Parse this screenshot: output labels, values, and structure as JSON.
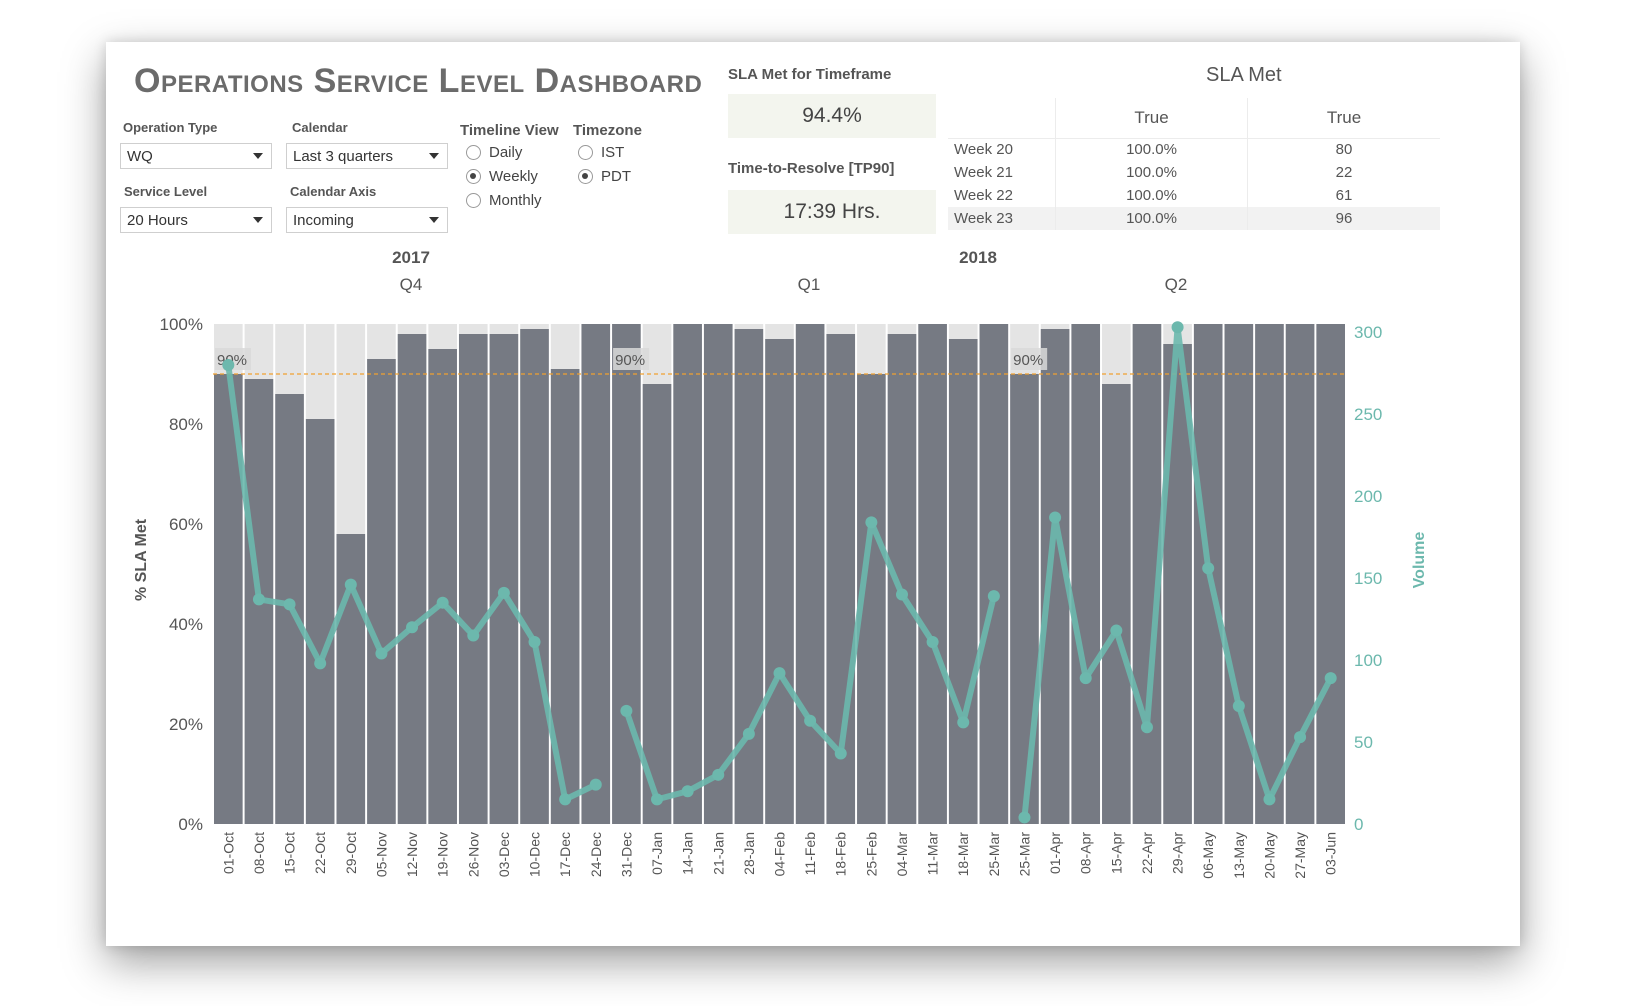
{
  "title": "Operations Service Level Dashboard",
  "filters": {
    "operation_type": {
      "label": "Operation Type",
      "value": "WQ"
    },
    "calendar": {
      "label": "Calendar",
      "value": "Last 3 quarters"
    },
    "service_level": {
      "label": "Service Level",
      "value": "20 Hours"
    },
    "calendar_axis": {
      "label": "Calendar Axis",
      "value": "Incoming"
    },
    "timeline_view": {
      "label": "Timeline View",
      "options": [
        "Daily",
        "Weekly",
        "Monthly"
      ],
      "selected": "Weekly"
    },
    "timezone": {
      "label": "Timezone",
      "options": [
        "IST",
        "PDT"
      ],
      "selected": "PDT"
    }
  },
  "kpis": {
    "sla_met_label": "SLA Met for Timeframe",
    "sla_met_value": "94.4%",
    "ttr_label": "Time-to-Resolve [TP90]",
    "ttr_value": "17:39 Hrs."
  },
  "sla_table": {
    "title": "SLA Met",
    "headers": [
      "",
      "True",
      "True"
    ],
    "rows": [
      [
        "Week 20",
        "100.0%",
        "80"
      ],
      [
        "Week 21",
        "100.0%",
        "22"
      ],
      [
        "Week 22",
        "100.0%",
        "61"
      ],
      [
        "Week 23",
        "100.0%",
        "96"
      ]
    ]
  },
  "chart_data": {
    "type": "bar+line",
    "year_labels": [
      {
        "year": "2017",
        "quarter": "Q4"
      },
      {
        "year": "2018",
        "quarter": "Q1"
      },
      {
        "year": "",
        "quarter": "Q2"
      }
    ],
    "ylabel_left": "% SLA Met",
    "ylabel_right": "Volume",
    "left_ticks": [
      "0%",
      "20%",
      "40%",
      "60%",
      "80%",
      "100%"
    ],
    "right_ticks": [
      "0",
      "50",
      "100",
      "150",
      "200",
      "250",
      "300"
    ],
    "ylim_left": [
      0,
      100
    ],
    "ylim_right": [
      0,
      305
    ],
    "target_line": {
      "value": 90,
      "label": "90%"
    },
    "categories": [
      "01-Oct",
      "08-Oct",
      "15-Oct",
      "22-Oct",
      "29-Oct",
      "05-Nov",
      "12-Nov",
      "19-Nov",
      "26-Nov",
      "03-Dec",
      "10-Dec",
      "17-Dec",
      "24-Dec",
      "31-Dec",
      "07-Jan",
      "14-Jan",
      "21-Jan",
      "28-Jan",
      "04-Feb",
      "11-Feb",
      "18-Feb",
      "25-Feb",
      "04-Mar",
      "11-Mar",
      "18-Mar",
      "25-Mar",
      "25-Mar",
      "01-Apr",
      "08-Apr",
      "15-Apr",
      "22-Apr",
      "29-Apr",
      "06-May",
      "13-May",
      "20-May",
      "27-May",
      "03-Jun"
    ],
    "sla_met_pct": [
      90,
      89,
      86,
      81,
      58,
      93,
      98,
      95,
      98,
      98,
      99,
      91,
      100,
      100,
      88,
      100,
      100,
      99,
      97,
      100,
      98,
      90,
      98,
      100,
      97,
      100,
      90,
      99,
      100,
      88,
      100,
      96,
      100,
      100,
      100,
      100,
      100
    ],
    "volume": [
      275,
      138,
      135,
      98,
      145,
      103,
      120,
      135,
      115,
      141,
      111,
      15,
      23,
      null,
      68,
      14,
      18,
      29,
      52,
      92,
      62,
      43,
      183,
      139,
      110,
      62,
      140,
      3,
      186,
      89,
      117,
      58,
      302,
      155,
      71,
      14,
      52,
      88
    ],
    "volume_segments_note": "",
    "volume_series": [
      {
        "i": 0,
        "v": 280
      },
      {
        "i": 1,
        "v": 137
      },
      {
        "i": 2,
        "v": 134
      },
      {
        "i": 3,
        "v": 98
      },
      {
        "i": 4,
        "v": 146
      },
      {
        "i": 5,
        "v": 104
      },
      {
        "i": 6,
        "v": 120
      },
      {
        "i": 7,
        "v": 135
      },
      {
        "i": 8,
        "v": 115
      },
      {
        "i": 9,
        "v": 141
      },
      {
        "i": 10,
        "v": 111
      },
      {
        "i": 11,
        "v": 15
      },
      {
        "i": 12,
        "v": 24
      },
      {
        "i": 13,
        "v": 69
      },
      {
        "i": 14,
        "v": 15
      },
      {
        "i": 15,
        "v": 20
      },
      {
        "i": 16,
        "v": 30
      },
      {
        "i": 17,
        "v": 55
      },
      {
        "i": 18,
        "v": 92
      },
      {
        "i": 19,
        "v": 63
      },
      {
        "i": 20,
        "v": 43
      },
      {
        "i": 21,
        "v": 184
      },
      {
        "i": 22,
        "v": 140
      },
      {
        "i": 23,
        "v": 111
      },
      {
        "i": 24,
        "v": 62
      },
      {
        "i": 25,
        "v": 139
      },
      {
        "i": 26,
        "v": 4
      },
      {
        "i": 27,
        "v": 187
      },
      {
        "i": 28,
        "v": 89
      },
      {
        "i": 29,
        "v": 118
      },
      {
        "i": 30,
        "v": 59
      },
      {
        "i": 31,
        "v": 303
      },
      {
        "i": 32,
        "v": 156
      },
      {
        "i": 33,
        "v": 72
      },
      {
        "i": 34,
        "v": 15
      },
      {
        "i": 35,
        "v": 53
      },
      {
        "i": 36,
        "v": 89
      }
    ],
    "volume_breaks_after": [
      12,
      25
    ],
    "colors": {
      "bar": "#767a83",
      "bar_bg": "#e4e4e4",
      "line": "#6cb8ad",
      "target": "#f0a030",
      "right_axis": "#6cb8ad"
    },
    "grid": false
  }
}
